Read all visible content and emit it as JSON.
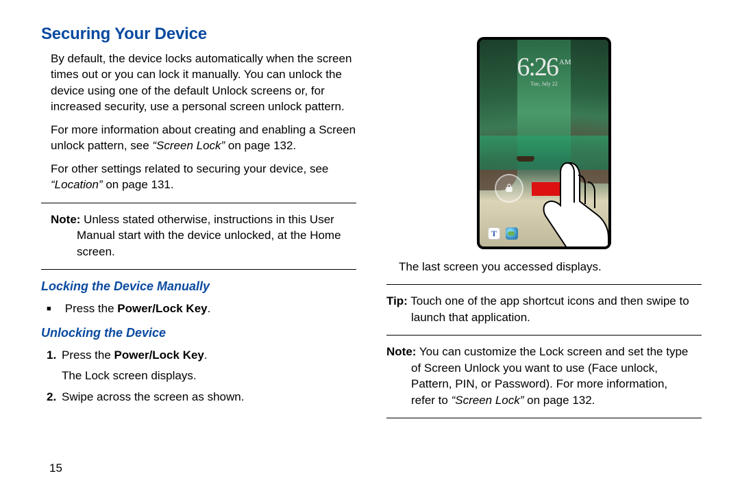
{
  "page_number": "15",
  "h1": "Securing Your Device",
  "intro_p1": "By default, the device locks automatically when the screen times out or you can lock it manually. You can unlock the device using one of the default Unlock screens or, for increased security, use a personal screen unlock pattern.",
  "intro_p2a": "For more information about creating and enabling a Screen unlock pattern, see ",
  "intro_p2_ital": "“Screen Lock”",
  "intro_p2b": " on page 132.",
  "intro_p3a": "For other settings related to securing your device, see ",
  "intro_p3_ital": "“Location”",
  "intro_p3b": " on page 131.",
  "note1_label": "Note:",
  "note1_body": " Unless stated otherwise, instructions in this User Manual start with the device unlocked, at the Home screen.",
  "h2_lock": "Locking the Device Manually",
  "lock_step_prefix": "Press the ",
  "lock_step_bold": "Power/Lock Key",
  "lock_step_suffix": ".",
  "h2_unlock": "Unlocking the Device",
  "unlock_s1_num": "1.",
  "unlock_s1_prefix": "Press the ",
  "unlock_s1_bold": "Power/Lock Key",
  "unlock_s1_suffix": ".",
  "unlock_s1_sub": "The Lock screen displays.",
  "unlock_s2_num": "2.",
  "unlock_s2_text": "Swipe across the screen as shown.",
  "phone_time": "6:26",
  "phone_ampm": "AM",
  "phone_date": "Tue, July 22",
  "phone_shortcut_t": "T",
  "after_image_caption": "The last screen you accessed displays.",
  "tip_label": "Tip:",
  "tip_body": " Touch one of the app shortcut icons and then swipe to launch that application.",
  "note2_label": "Note:",
  "note2_body_a": " You can customize the Lock screen and set the type of Screen Unlock you want to use (Face unlock, Pattern, PIN, or Password). For more information, refer to ",
  "note2_ital": "“Screen Lock”",
  "note2_body_b": " on page 132."
}
